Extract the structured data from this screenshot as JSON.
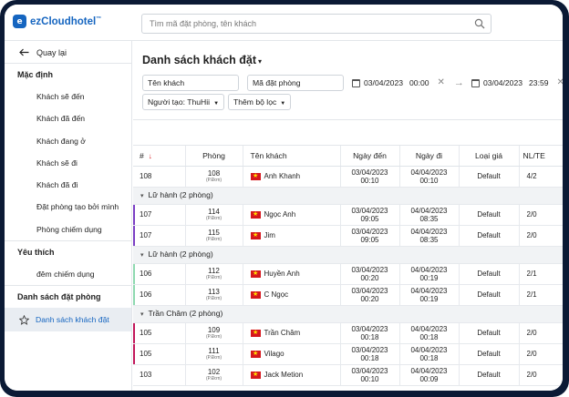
{
  "app": {
    "logo_mark": "e",
    "logo_text": "ezCloudhotel",
    "logo_tm": "™"
  },
  "search": {
    "placeholder": "Tìm mã đặt phòng, tên khách"
  },
  "sidebar": {
    "back_label": "Quay lại",
    "groups": [
      {
        "label": "Mặc định",
        "items": [
          "Khách sẽ đến",
          "Khách đã đến",
          "Khách đang ở",
          "Khách sẽ đi",
          "Khách đã đi",
          "Đặt phòng tạo bởi mình",
          "Phòng chiếm dụng"
        ]
      },
      {
        "label": "Yêu thích",
        "items": [
          "đêm chiếm dụng"
        ]
      },
      {
        "label": "Danh sách đặt phòng",
        "items": []
      }
    ],
    "active_item": "Danh sách khách đặt"
  },
  "main": {
    "title": "Danh sách khách đặt",
    "filters": {
      "guest_name": "Tên khách",
      "booking_code": "Mã đặt phòng",
      "from_date": "03/04/2023",
      "from_time": "00:00",
      "to_date": "03/04/2023",
      "to_time": "23:59",
      "creator": "Người tạo: ThuHii",
      "add_filter": "Thêm bộ lọc"
    },
    "columns": [
      "#",
      "Phòng",
      "Tên khách",
      "Ngày đến",
      "Ngày đi",
      "Loại giá",
      "NL/TE"
    ],
    "rows": [
      {
        "type": "row",
        "id": "108",
        "room": "108",
        "room_sub": "(P.Đơn)",
        "guest": "Anh Khanh",
        "arrive_date": "03/04/2023",
        "arrive_time": "00:10",
        "depart_date": "04/04/2023",
        "depart_time": "00:10",
        "rate": "Default",
        "pax": "4/2",
        "bar": ""
      },
      {
        "type": "group",
        "label": "Lữ hành (2 phòng)"
      },
      {
        "type": "row",
        "id": "107",
        "room": "114",
        "room_sub": "(P.Đơn)",
        "guest": "Ngọc Anh",
        "arrive_date": "03/04/2023",
        "arrive_time": "09:05",
        "depart_date": "04/04/2023",
        "depart_time": "08:35",
        "rate": "Default",
        "pax": "2/0",
        "bar": "#7b3fc4"
      },
      {
        "type": "row",
        "id": "107",
        "room": "115",
        "room_sub": "(P.Đơn)",
        "guest": "Jim",
        "arrive_date": "03/04/2023",
        "arrive_time": "09:05",
        "depart_date": "04/04/2023",
        "depart_time": "08:35",
        "rate": "Default",
        "pax": "2/0",
        "bar": "#7b3fc4"
      },
      {
        "type": "group",
        "label": "Lữ hành (2 phòng)"
      },
      {
        "type": "row",
        "id": "106",
        "room": "112",
        "room_sub": "(P.Đơn)",
        "guest": "Huyền Anh",
        "arrive_date": "03/04/2023",
        "arrive_time": "00:20",
        "depart_date": "04/04/2023",
        "depart_time": "00:19",
        "rate": "Default",
        "pax": "2/1",
        "bar": "#8fd9b0"
      },
      {
        "type": "row",
        "id": "106",
        "room": "113",
        "room_sub": "(P.Đơn)",
        "guest": "C Ngọc",
        "arrive_date": "03/04/2023",
        "arrive_time": "00:20",
        "depart_date": "04/04/2023",
        "depart_time": "00:19",
        "rate": "Default",
        "pax": "2/1",
        "bar": "#8fd9b0"
      },
      {
        "type": "group",
        "label": "Trần Châm (2 phòng)"
      },
      {
        "type": "row",
        "id": "105",
        "room": "109",
        "room_sub": "(P.Đơn)",
        "guest": "Trần Châm",
        "arrive_date": "03/04/2023",
        "arrive_time": "00:18",
        "depart_date": "04/04/2023",
        "depart_time": "00:18",
        "rate": "Default",
        "pax": "2/0",
        "bar": "#c2185b"
      },
      {
        "type": "row",
        "id": "105",
        "room": "111",
        "room_sub": "(P.Đơn)",
        "guest": "Vilago",
        "arrive_date": "03/04/2023",
        "arrive_time": "00:18",
        "depart_date": "04/04/2023",
        "depart_time": "00:18",
        "rate": "Default",
        "pax": "2/0",
        "bar": "#c2185b"
      },
      {
        "type": "row",
        "id": "103",
        "room": "102",
        "room_sub": "(P.Đơn)",
        "guest": "Jack Metion",
        "arrive_date": "03/04/2023",
        "arrive_time": "00:10",
        "depart_date": "04/04/2023",
        "depart_time": "00:09",
        "rate": "Default",
        "pax": "2/0",
        "bar": ""
      }
    ]
  },
  "colors": {
    "brand": "#1565c0",
    "frame": "#0b1a35",
    "sort_arrow": "#d6161c"
  },
  "icons": {
    "search": "search-icon",
    "back": "arrow-left-icon",
    "star": "star-icon",
    "calendar": "calendar-icon",
    "clear": "close-icon",
    "range": "arrow-right-icon",
    "flag": "vietnam-flag-icon"
  }
}
